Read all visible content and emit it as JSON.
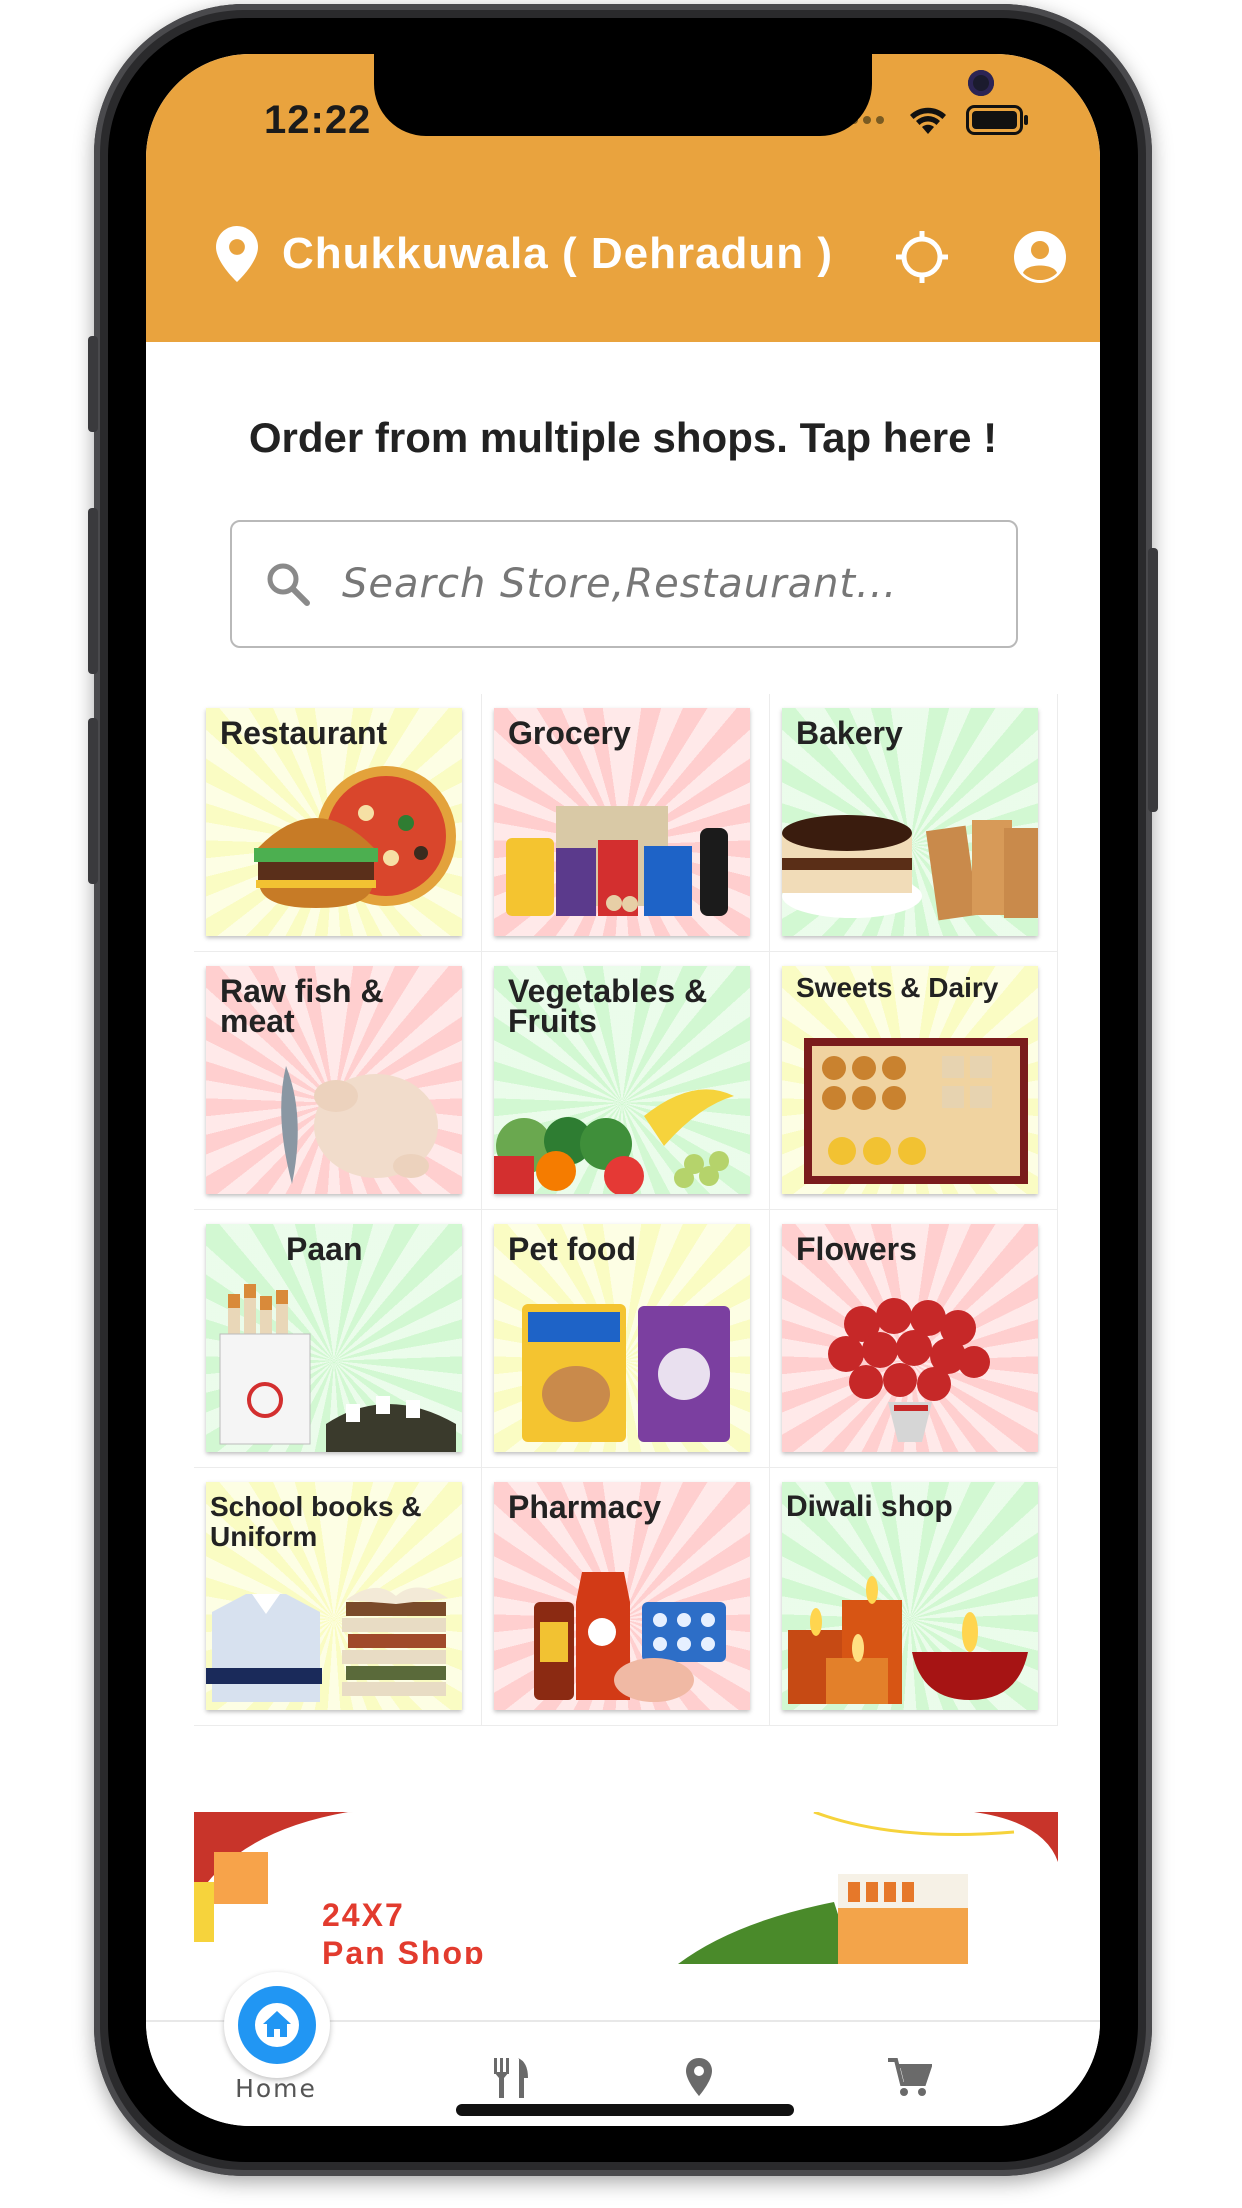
{
  "status_bar": {
    "time": "12:22"
  },
  "header": {
    "location": "Chukkuwala ( Dehradun )"
  },
  "tagline": "Order from multiple shops. Tap here !",
  "search": {
    "placeholder": "Search Store,Restaurant..."
  },
  "categories": [
    {
      "label": "Restaurant",
      "bg": "#fafcc3"
    },
    {
      "label": "Grocery",
      "bg": "#ffcece"
    },
    {
      "label": "Bakery",
      "bg": "#d2f8d2"
    },
    {
      "label": "Raw fish & meat",
      "bg": "#ffcfcf"
    },
    {
      "label": "Vegetables & Fruits",
      "bg": "#d2f8d2"
    },
    {
      "label": "Sweets & Dairy",
      "bg": "#fafcc3"
    },
    {
      "label": "Paan",
      "bg": "#d2f8d2"
    },
    {
      "label": "Pet food",
      "bg": "#fafcc3"
    },
    {
      "label": "Flowers",
      "bg": "#ffcfcf"
    },
    {
      "label": "School books & Uniform",
      "bg": "#fafcc3"
    },
    {
      "label": "Pharmacy",
      "bg": "#ffcfcf"
    },
    {
      "label": "Diwali shop",
      "bg": "#d2f8d2"
    }
  ],
  "banner": {
    "line1": "24X7",
    "line2": "Pan Shop"
  },
  "bottom_nav": {
    "home_label": "Home",
    "items": [
      "home-icon",
      "restaurant-icon",
      "location-icon",
      "cart-icon"
    ]
  },
  "colors": {
    "header": "#e9a33e",
    "accent": "#2196f3"
  }
}
